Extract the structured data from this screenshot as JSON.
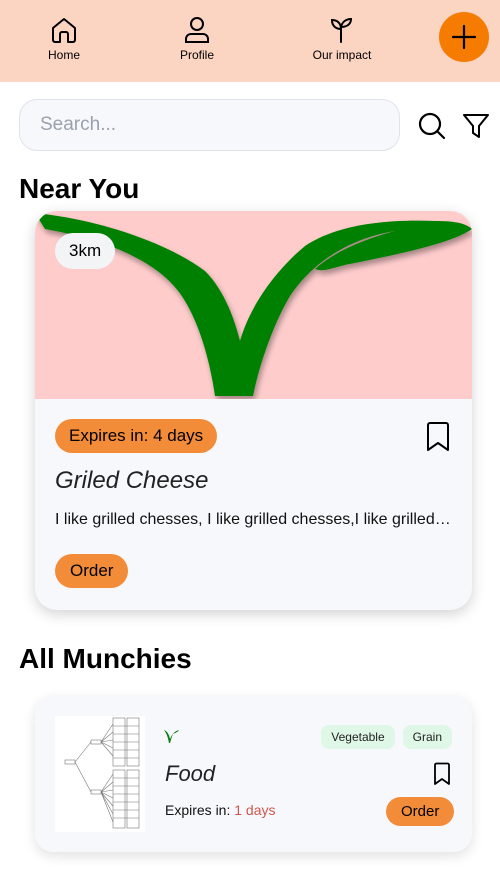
{
  "nav": {
    "items": [
      {
        "label": "Home",
        "icon": "home-icon"
      },
      {
        "label": "Profile",
        "icon": "profile-icon"
      },
      {
        "label": "Our impact",
        "icon": "sprout-icon"
      }
    ],
    "add_icon": "plus-icon",
    "background": "#fcd4c2",
    "accent": "#f57c00"
  },
  "search": {
    "placeholder": "Search...",
    "value": "",
    "search_icon": "search-icon",
    "filter_icon": "filter-icon"
  },
  "near_you": {
    "title": "Near You",
    "card": {
      "distance": "3km",
      "image_icon": "vegan-leaf-logo",
      "image_background": "#ffcccc",
      "expires": "Expires in: 4 days",
      "name": "Griled Cheese",
      "description": "I like grilled chesses, I like grilled chesses,I like grilled chesses, I like grilled chesses",
      "order_label": "Order",
      "bookmark_icon": "bookmark-icon"
    }
  },
  "all_munchies": {
    "title": "All Munchies",
    "items": [
      {
        "thumbnail": "tree-diagram-thumbnail",
        "diet_icon": "vegan-leaf-icon",
        "tags": [
          "Vegetable",
          "Grain"
        ],
        "name": "Food",
        "expires_label": "Expires in: ",
        "expires_value": "1 days",
        "order_label": "Order",
        "bookmark_icon": "bookmark-icon"
      }
    ]
  },
  "colors": {
    "badge_orange": "#f28c38",
    "tag_green": "#dff7e6",
    "expires_red": "#d0574c",
    "leaf_green": "#008000"
  }
}
